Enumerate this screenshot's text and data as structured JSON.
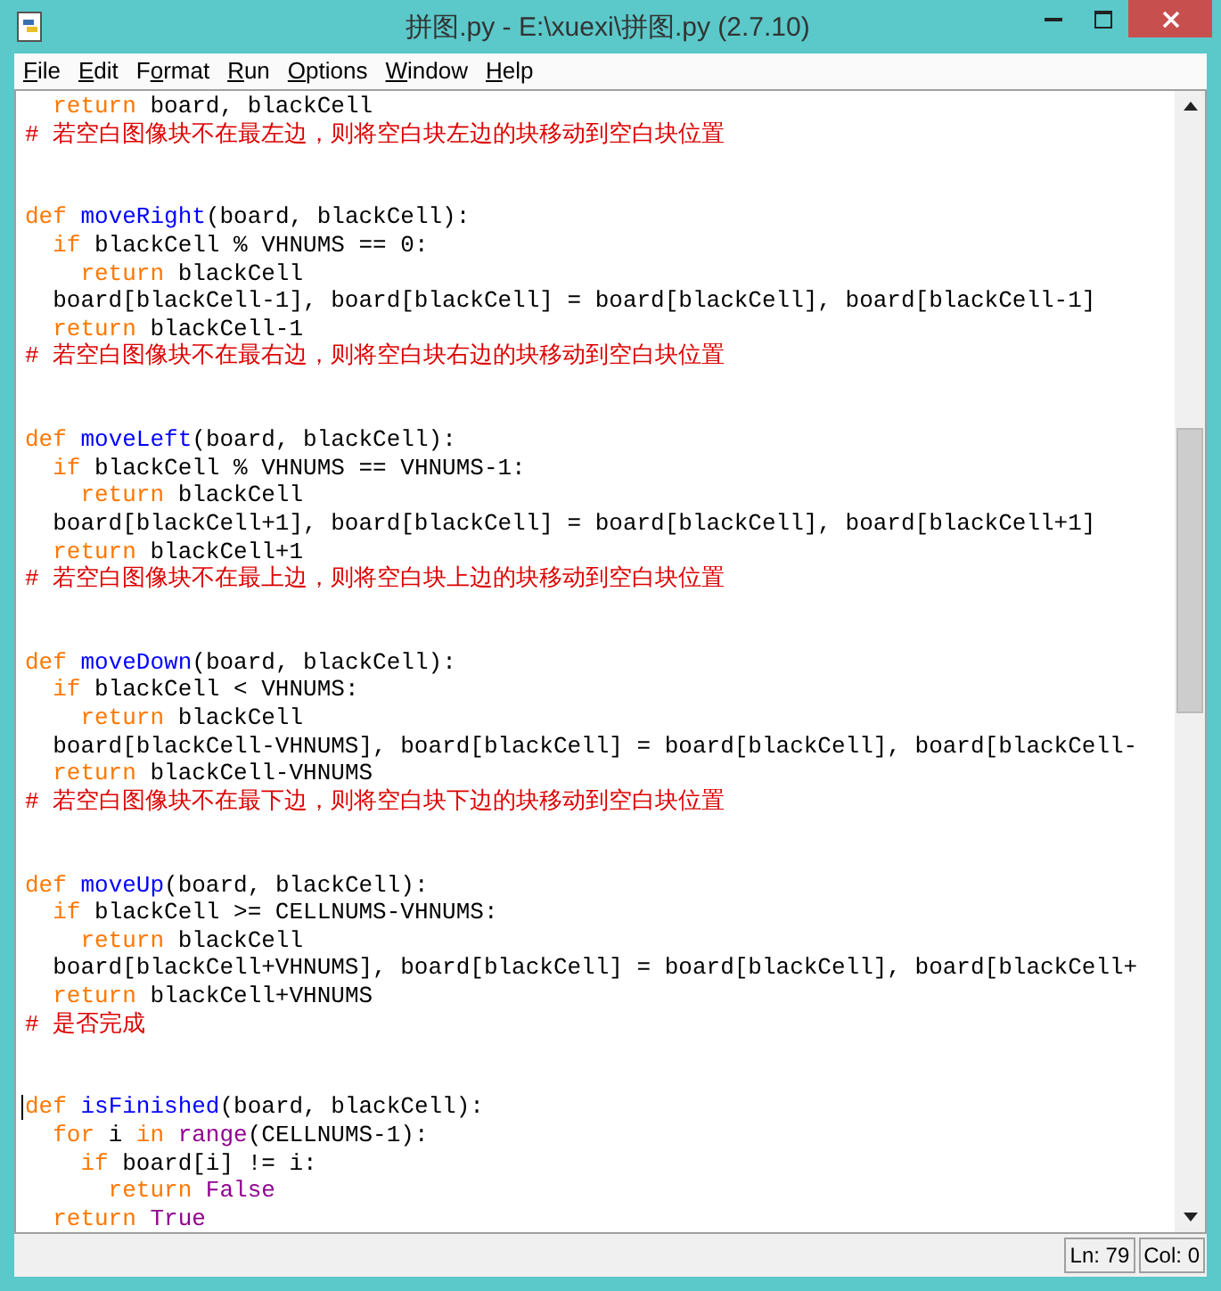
{
  "window": {
    "title": "拼图.py - E:\\xuexi\\拼图.py (2.7.10)"
  },
  "menu": [
    {
      "underlined": "F",
      "after": "ile"
    },
    {
      "underlined": "E",
      "after": "dit"
    },
    {
      "before": "F",
      "underlined": "o",
      "after": "rmat"
    },
    {
      "underlined": "R",
      "after": "un"
    },
    {
      "underlined": "O",
      "after": "ptions"
    },
    {
      "underlined": "W",
      "after": "indow"
    },
    {
      "underlined": "H",
      "after": "elp"
    }
  ],
  "editor": {
    "lines": [
      {
        "kind": "code",
        "cursor": false,
        "segments": [
          {
            "t": "  return",
            "kind": "keyword"
          },
          {
            "t": " board, blackCell",
            "kind": "plain"
          }
        ]
      },
      {
        "kind": "code",
        "cursor": false,
        "segments": [
          {
            "t": "# 若空白图像块不在最左边，则将空白块左边的块移动到空白块位置",
            "kind": "comment"
          }
        ]
      },
      {
        "kind": "blank"
      },
      {
        "kind": "blank"
      },
      {
        "kind": "code",
        "cursor": false,
        "segments": [
          {
            "t": "def ",
            "kind": "keyword"
          },
          {
            "t": "moveRight",
            "kind": "defname"
          },
          {
            "t": "(board, blackCell):",
            "kind": "plain"
          }
        ]
      },
      {
        "kind": "code",
        "cursor": false,
        "segments": [
          {
            "t": "  if",
            "kind": "keyword"
          },
          {
            "t": " blackCell % VHNUMS == 0:",
            "kind": "plain"
          }
        ]
      },
      {
        "kind": "code",
        "cursor": false,
        "segments": [
          {
            "t": "    return",
            "kind": "keyword"
          },
          {
            "t": " blackCell",
            "kind": "plain"
          }
        ]
      },
      {
        "kind": "code",
        "cursor": false,
        "segments": [
          {
            "t": "  board[blackCell-1], board[blackCell] = board[blackCell], board[blackCell-1]",
            "kind": "plain"
          }
        ]
      },
      {
        "kind": "code",
        "cursor": false,
        "segments": [
          {
            "t": "  return",
            "kind": "keyword"
          },
          {
            "t": " blackCell-1",
            "kind": "plain"
          }
        ]
      },
      {
        "kind": "code",
        "cursor": false,
        "segments": [
          {
            "t": "# 若空白图像块不在最右边，则将空白块右边的块移动到空白块位置",
            "kind": "comment"
          }
        ]
      },
      {
        "kind": "blank"
      },
      {
        "kind": "blank"
      },
      {
        "kind": "code",
        "cursor": false,
        "segments": [
          {
            "t": "def ",
            "kind": "keyword"
          },
          {
            "t": "moveLeft",
            "kind": "defname"
          },
          {
            "t": "(board, blackCell):",
            "kind": "plain"
          }
        ]
      },
      {
        "kind": "code",
        "cursor": false,
        "segments": [
          {
            "t": "  if",
            "kind": "keyword"
          },
          {
            "t": " blackCell % VHNUMS == VHNUMS-1:",
            "kind": "plain"
          }
        ]
      },
      {
        "kind": "code",
        "cursor": false,
        "segments": [
          {
            "t": "    return",
            "kind": "keyword"
          },
          {
            "t": " blackCell",
            "kind": "plain"
          }
        ]
      },
      {
        "kind": "code",
        "cursor": false,
        "segments": [
          {
            "t": "  board[blackCell+1], board[blackCell] = board[blackCell], board[blackCell+1]",
            "kind": "plain"
          }
        ]
      },
      {
        "kind": "code",
        "cursor": false,
        "segments": [
          {
            "t": "  return",
            "kind": "keyword"
          },
          {
            "t": " blackCell+1",
            "kind": "plain"
          }
        ]
      },
      {
        "kind": "code",
        "cursor": false,
        "segments": [
          {
            "t": "# 若空白图像块不在最上边，则将空白块上边的块移动到空白块位置",
            "kind": "comment"
          }
        ]
      },
      {
        "kind": "blank"
      },
      {
        "kind": "blank"
      },
      {
        "kind": "code",
        "cursor": false,
        "segments": [
          {
            "t": "def ",
            "kind": "keyword"
          },
          {
            "t": "moveDown",
            "kind": "defname"
          },
          {
            "t": "(board, blackCell):",
            "kind": "plain"
          }
        ]
      },
      {
        "kind": "code",
        "cursor": false,
        "segments": [
          {
            "t": "  if",
            "kind": "keyword"
          },
          {
            "t": " blackCell < VHNUMS:",
            "kind": "plain"
          }
        ]
      },
      {
        "kind": "code",
        "cursor": false,
        "segments": [
          {
            "t": "    return",
            "kind": "keyword"
          },
          {
            "t": " blackCell",
            "kind": "plain"
          }
        ]
      },
      {
        "kind": "code",
        "cursor": false,
        "segments": [
          {
            "t": "  board[blackCell-VHNUMS], board[blackCell] = board[blackCell], board[blackCell-",
            "kind": "plain"
          }
        ]
      },
      {
        "kind": "code",
        "cursor": false,
        "segments": [
          {
            "t": "  return",
            "kind": "keyword"
          },
          {
            "t": " blackCell-VHNUMS",
            "kind": "plain"
          }
        ]
      },
      {
        "kind": "code",
        "cursor": false,
        "segments": [
          {
            "t": "# 若空白图像块不在最下边，则将空白块下边的块移动到空白块位置",
            "kind": "comment"
          }
        ]
      },
      {
        "kind": "blank"
      },
      {
        "kind": "blank"
      },
      {
        "kind": "code",
        "cursor": false,
        "segments": [
          {
            "t": "def ",
            "kind": "keyword"
          },
          {
            "t": "moveUp",
            "kind": "defname"
          },
          {
            "t": "(board, blackCell):",
            "kind": "plain"
          }
        ]
      },
      {
        "kind": "code",
        "cursor": false,
        "segments": [
          {
            "t": "  if",
            "kind": "keyword"
          },
          {
            "t": " blackCell >= CELLNUMS-VHNUMS:",
            "kind": "plain"
          }
        ]
      },
      {
        "kind": "code",
        "cursor": false,
        "segments": [
          {
            "t": "    return",
            "kind": "keyword"
          },
          {
            "t": " blackCell",
            "kind": "plain"
          }
        ]
      },
      {
        "kind": "code",
        "cursor": false,
        "segments": [
          {
            "t": "  board[blackCell+VHNUMS], board[blackCell] = board[blackCell], board[blackCell+",
            "kind": "plain"
          }
        ]
      },
      {
        "kind": "code",
        "cursor": false,
        "segments": [
          {
            "t": "  return",
            "kind": "keyword"
          },
          {
            "t": " blackCell+VHNUMS",
            "kind": "plain"
          }
        ]
      },
      {
        "kind": "code",
        "cursor": false,
        "segments": [
          {
            "t": "# 是否完成",
            "kind": "comment"
          }
        ]
      },
      {
        "kind": "blank"
      },
      {
        "kind": "blank"
      },
      {
        "kind": "code",
        "cursor": true,
        "segments": [
          {
            "t": "def ",
            "kind": "keyword"
          },
          {
            "t": "isFinished",
            "kind": "defname"
          },
          {
            "t": "(board, blackCell):",
            "kind": "plain"
          }
        ]
      },
      {
        "kind": "code",
        "cursor": false,
        "segments": [
          {
            "t": "  for",
            "kind": "keyword"
          },
          {
            "t": " i ",
            "kind": "plain"
          },
          {
            "t": "in ",
            "kind": "keyword"
          },
          {
            "t": "range",
            "kind": "builtin"
          },
          {
            "t": "(CELLNUMS-1):",
            "kind": "plain"
          }
        ]
      },
      {
        "kind": "code",
        "cursor": false,
        "segments": [
          {
            "t": "    if",
            "kind": "keyword"
          },
          {
            "t": " board[i] != i:",
            "kind": "plain"
          }
        ]
      },
      {
        "kind": "code",
        "cursor": false,
        "segments": [
          {
            "t": "      return ",
            "kind": "keyword"
          },
          {
            "t": "False",
            "kind": "builtin"
          }
        ]
      },
      {
        "kind": "code",
        "cursor": false,
        "segments": [
          {
            "t": "  return ",
            "kind": "keyword"
          },
          {
            "t": "True",
            "kind": "builtin"
          }
        ]
      }
    ]
  },
  "status_bar": {
    "line": "Ln: 79",
    "column": "Col: 0"
  }
}
